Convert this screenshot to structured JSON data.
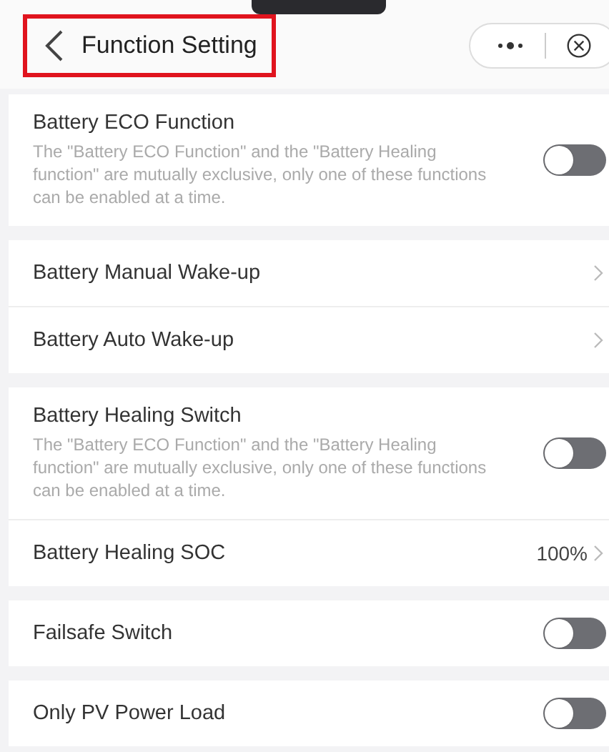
{
  "header": {
    "title": "Function Setting",
    "highlighted": true
  },
  "groups": [
    {
      "items": [
        {
          "kind": "toggle",
          "label": "Battery ECO Function",
          "description": "The \"Battery ECO Function\" and the \"Battery Healing function\" are mutually exclusive, only one of these functions can be enabled at a time.",
          "on": false
        }
      ]
    },
    {
      "items": [
        {
          "kind": "link",
          "label": "Battery Manual Wake-up"
        },
        {
          "kind": "link",
          "label": "Battery Auto Wake-up"
        }
      ]
    },
    {
      "items": [
        {
          "kind": "toggle",
          "label": "Battery Healing Switch",
          "description": "The \"Battery ECO Function\" and the \"Battery Healing function\" are mutually exclusive, only one of these functions can be enabled at a time.",
          "on": false
        },
        {
          "kind": "link",
          "label": "Battery Healing SOC",
          "value": "100%"
        }
      ]
    },
    {
      "items": [
        {
          "kind": "toggle",
          "label": "Failsafe Switch",
          "on": false
        }
      ]
    },
    {
      "items": [
        {
          "kind": "toggle",
          "label": "Only PV Power Load",
          "on": false
        }
      ]
    }
  ]
}
